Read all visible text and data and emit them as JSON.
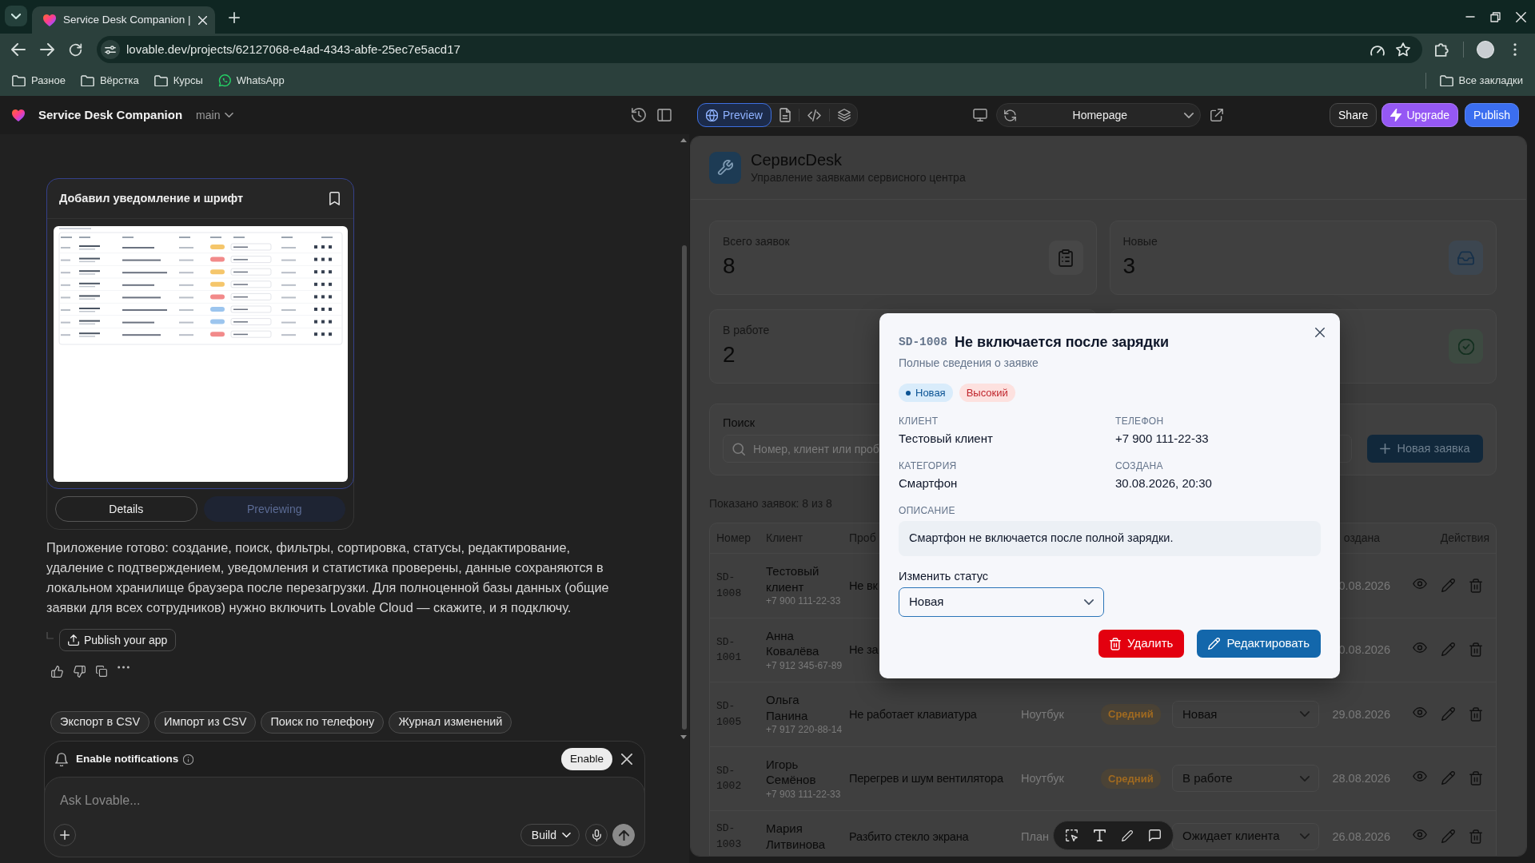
{
  "browser": {
    "tabs": [
      {
        "title": "Service Desk Companion |",
        "selected": true
      }
    ],
    "address": "lovable.dev/projects/62127068-e4ad-4343-abfe-25ec7e5acd17",
    "bookmarks": [
      {
        "kind": "folder",
        "label": "Разное"
      },
      {
        "kind": "folder",
        "label": "Вёрстка"
      },
      {
        "kind": "folder",
        "label": "Курсы"
      },
      {
        "kind": "whatsapp",
        "label": "WhatsApp"
      }
    ],
    "all_bookmarks": "Все закладки"
  },
  "editor_bar": {
    "project": "Service Desk Companion",
    "branch": "main",
    "view_tabs": [
      {
        "kind": "preview",
        "label": "Preview",
        "selected": true
      },
      {
        "kind": "file",
        "selected": false
      },
      {
        "kind": "code",
        "selected": false
      },
      {
        "kind": "layers",
        "selected": false
      }
    ],
    "page": "Homepage",
    "buttons": [
      {
        "kind": "share",
        "label": "Share"
      },
      {
        "kind": "upgrade",
        "label": "Upgrade"
      },
      {
        "kind": "publish",
        "label": "Publish"
      }
    ]
  },
  "chat": {
    "version_card": {
      "title": "Добавил уведомление и шрифт",
      "buttons": [
        {
          "label": "Details",
          "selected": false
        },
        {
          "label": "Previewing",
          "selected": true
        }
      ]
    },
    "message": "Приложение готово: создание, поиск, фильтры, сортировка, статусы, редактирование, удаление с подтверждением, уведомления и статистика проверены, данные сохраняются в локальном хранилище браузера после перезагрузки. Для полноценной базы данных (общие заявки для всех сотрудников) нужно включить Lovable Cloud — скажите, и я подключу.",
    "publish_button": "Publish your app",
    "suggestions": [
      "Экспорт в CSV",
      "Импорт из CSV",
      "Поиск по телефону",
      "Журнал изменений"
    ],
    "notification": {
      "text": "Enable notifications",
      "button": "Enable"
    },
    "composer": {
      "placeholder": "Ask Lovable...",
      "mode": "Build"
    }
  },
  "preview": {
    "app": {
      "title": "СервисDesk",
      "subtitle": "Управление заявками сервисного центра",
      "stats": [
        {
          "kind": "total",
          "label": "Всего заявок",
          "value": "8"
        },
        {
          "kind": "new",
          "label": "Новые",
          "value": "3"
        },
        {
          "kind": "in_progress",
          "label": "В работе",
          "value": "2"
        },
        {
          "kind": "done"
        }
      ],
      "search": {
        "label": "Поиск",
        "placeholder": "Номер, клиент или проб"
      },
      "new_button": "Новая заявка",
      "count": "Показано заявок: 8 из 8",
      "table": {
        "columns": [
          {
            "kind": "number",
            "label": "Номер"
          },
          {
            "kind": "client",
            "label": "Клиент"
          },
          {
            "kind": "column_3",
            "label": "Проб"
          },
          {
            "kind": "column_7",
            "label": "оздана"
          },
          {
            "kind": "actions",
            "label": "Действия"
          }
        ],
        "rows": [
          {
            "number": "SD-1008",
            "client": "Тестовый клиент",
            "phone": "+7 900 111-22-33",
            "column_3": "Не вк",
            "column_7": "0.08.2026"
          },
          {
            "number": "SD-1001",
            "client": "Анна Ковалёва",
            "phone": "+7 912 345-67-89",
            "column_3": "Не за",
            "column_7": "0.08.2026"
          },
          {
            "number": "SD-1005",
            "client": "Ольга Панина",
            "phone": "+7 917 220-88-14",
            "column_3": "Не работает клавиатура",
            "column_4": "Ноутбук",
            "column_5": {
              "kind": "medium",
              "text": "Средний"
            },
            "column_6": "Новая",
            "column_7": "29.08.2026"
          },
          {
            "number": "SD-1002",
            "client": "Игорь Семёнов",
            "phone": "+7 903 111-22-33",
            "column_3": "Перегрев и шум вентилятора",
            "column_4": "Ноутбук",
            "column_5": {
              "kind": "medium",
              "text": "Средний"
            },
            "column_6": "В работе",
            "column_7": "28.08.2026"
          },
          {
            "number": "SD-1003",
            "client": "Мария Литвинова",
            "column_3": "Разбито стекло экрана",
            "column_4": "План",
            "column_6": "Ожидает клиента",
            "column_7": "26.08.2026"
          }
        ]
      }
    },
    "modal": {
      "number": "SD-1008",
      "title": "Не включается после зарядки",
      "subtitle": "Полные сведения о заявке",
      "badges": [
        {
          "kind": "status",
          "text": "Новая"
        },
        {
          "kind": "high",
          "text": "Высокий"
        }
      ],
      "fields": [
        {
          "label": "КЛИЕНТ",
          "value": "Тестовый клиент"
        },
        {
          "label": "ТЕЛЕФОН",
          "value": "+7 900 111-22-33"
        },
        {
          "label": "КАТЕГОРИЯ",
          "value": "Смартфон"
        },
        {
          "label": "СОЗДАНА",
          "value": "30.08.2026, 20:30"
        }
      ],
      "description_label": "ОПИСАНИЕ",
      "description": "Смартфон не включается после полной зарядки.",
      "status_label": "Изменить статус",
      "status": "Новая",
      "buttons": [
        {
          "kind": "delete",
          "label": "Удалить"
        },
        {
          "kind": "edit",
          "label": "Редактировать"
        }
      ]
    }
  }
}
